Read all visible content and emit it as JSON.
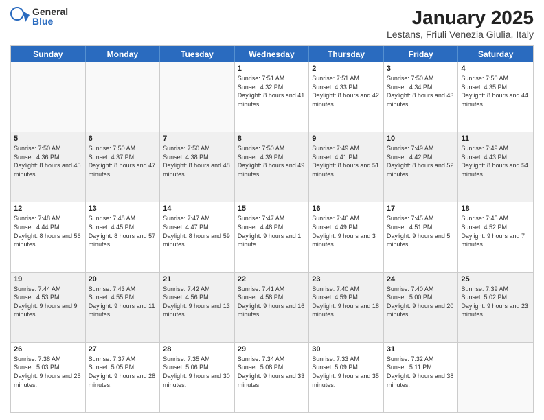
{
  "logo": {
    "general": "General",
    "blue": "Blue"
  },
  "title": "January 2025",
  "subtitle": "Lestans, Friuli Venezia Giulia, Italy",
  "dayHeaders": [
    "Sunday",
    "Monday",
    "Tuesday",
    "Wednesday",
    "Thursday",
    "Friday",
    "Saturday"
  ],
  "weeks": [
    [
      {
        "num": "",
        "info": ""
      },
      {
        "num": "",
        "info": ""
      },
      {
        "num": "",
        "info": ""
      },
      {
        "num": "1",
        "info": "Sunrise: 7:51 AM\nSunset: 4:32 PM\nDaylight: 8 hours and 41 minutes."
      },
      {
        "num": "2",
        "info": "Sunrise: 7:51 AM\nSunset: 4:33 PM\nDaylight: 8 hours and 42 minutes."
      },
      {
        "num": "3",
        "info": "Sunrise: 7:50 AM\nSunset: 4:34 PM\nDaylight: 8 hours and 43 minutes."
      },
      {
        "num": "4",
        "info": "Sunrise: 7:50 AM\nSunset: 4:35 PM\nDaylight: 8 hours and 44 minutes."
      }
    ],
    [
      {
        "num": "5",
        "info": "Sunrise: 7:50 AM\nSunset: 4:36 PM\nDaylight: 8 hours and 45 minutes."
      },
      {
        "num": "6",
        "info": "Sunrise: 7:50 AM\nSunset: 4:37 PM\nDaylight: 8 hours and 47 minutes."
      },
      {
        "num": "7",
        "info": "Sunrise: 7:50 AM\nSunset: 4:38 PM\nDaylight: 8 hours and 48 minutes."
      },
      {
        "num": "8",
        "info": "Sunrise: 7:50 AM\nSunset: 4:39 PM\nDaylight: 8 hours and 49 minutes."
      },
      {
        "num": "9",
        "info": "Sunrise: 7:49 AM\nSunset: 4:41 PM\nDaylight: 8 hours and 51 minutes."
      },
      {
        "num": "10",
        "info": "Sunrise: 7:49 AM\nSunset: 4:42 PM\nDaylight: 8 hours and 52 minutes."
      },
      {
        "num": "11",
        "info": "Sunrise: 7:49 AM\nSunset: 4:43 PM\nDaylight: 8 hours and 54 minutes."
      }
    ],
    [
      {
        "num": "12",
        "info": "Sunrise: 7:48 AM\nSunset: 4:44 PM\nDaylight: 8 hours and 56 minutes."
      },
      {
        "num": "13",
        "info": "Sunrise: 7:48 AM\nSunset: 4:45 PM\nDaylight: 8 hours and 57 minutes."
      },
      {
        "num": "14",
        "info": "Sunrise: 7:47 AM\nSunset: 4:47 PM\nDaylight: 8 hours and 59 minutes."
      },
      {
        "num": "15",
        "info": "Sunrise: 7:47 AM\nSunset: 4:48 PM\nDaylight: 9 hours and 1 minute."
      },
      {
        "num": "16",
        "info": "Sunrise: 7:46 AM\nSunset: 4:49 PM\nDaylight: 9 hours and 3 minutes."
      },
      {
        "num": "17",
        "info": "Sunrise: 7:45 AM\nSunset: 4:51 PM\nDaylight: 9 hours and 5 minutes."
      },
      {
        "num": "18",
        "info": "Sunrise: 7:45 AM\nSunset: 4:52 PM\nDaylight: 9 hours and 7 minutes."
      }
    ],
    [
      {
        "num": "19",
        "info": "Sunrise: 7:44 AM\nSunset: 4:53 PM\nDaylight: 9 hours and 9 minutes."
      },
      {
        "num": "20",
        "info": "Sunrise: 7:43 AM\nSunset: 4:55 PM\nDaylight: 9 hours and 11 minutes."
      },
      {
        "num": "21",
        "info": "Sunrise: 7:42 AM\nSunset: 4:56 PM\nDaylight: 9 hours and 13 minutes."
      },
      {
        "num": "22",
        "info": "Sunrise: 7:41 AM\nSunset: 4:58 PM\nDaylight: 9 hours and 16 minutes."
      },
      {
        "num": "23",
        "info": "Sunrise: 7:40 AM\nSunset: 4:59 PM\nDaylight: 9 hours and 18 minutes."
      },
      {
        "num": "24",
        "info": "Sunrise: 7:40 AM\nSunset: 5:00 PM\nDaylight: 9 hours and 20 minutes."
      },
      {
        "num": "25",
        "info": "Sunrise: 7:39 AM\nSunset: 5:02 PM\nDaylight: 9 hours and 23 minutes."
      }
    ],
    [
      {
        "num": "26",
        "info": "Sunrise: 7:38 AM\nSunset: 5:03 PM\nDaylight: 9 hours and 25 minutes."
      },
      {
        "num": "27",
        "info": "Sunrise: 7:37 AM\nSunset: 5:05 PM\nDaylight: 9 hours and 28 minutes."
      },
      {
        "num": "28",
        "info": "Sunrise: 7:35 AM\nSunset: 5:06 PM\nDaylight: 9 hours and 30 minutes."
      },
      {
        "num": "29",
        "info": "Sunrise: 7:34 AM\nSunset: 5:08 PM\nDaylight: 9 hours and 33 minutes."
      },
      {
        "num": "30",
        "info": "Sunrise: 7:33 AM\nSunset: 5:09 PM\nDaylight: 9 hours and 35 minutes."
      },
      {
        "num": "31",
        "info": "Sunrise: 7:32 AM\nSunset: 5:11 PM\nDaylight: 9 hours and 38 minutes."
      },
      {
        "num": "",
        "info": ""
      }
    ]
  ]
}
